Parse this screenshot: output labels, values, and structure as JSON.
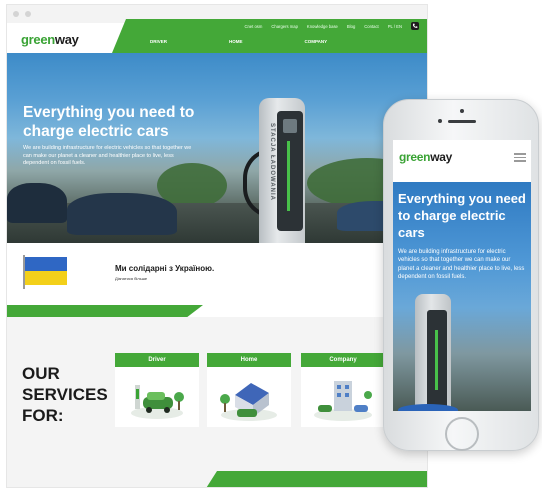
{
  "brand": {
    "name_part1": "green",
    "name_part2": "way",
    "accent_color": "#44a838"
  },
  "topbar": {
    "links": [
      "Cnet osm",
      "Chargers map",
      "Knowledge base",
      "Blog",
      "Contact",
      "PL / EN"
    ],
    "phone_icon": "phone-icon"
  },
  "nav": {
    "items": [
      "DRIVER",
      "HOME",
      "COMPANY"
    ]
  },
  "hero": {
    "title": "Everything you need to charge electric cars",
    "text": "We are building infrastructure for electric vehicles so that together we can make our planet a cleaner and healthier place to live, less dependent on fossil fuels.",
    "charger_label": "STACJA ŁADOWANIA"
  },
  "ukraine": {
    "title": "Ми солідарні з Україною.",
    "link": "Дізнатися більше"
  },
  "services": {
    "title_lines": [
      "OUR",
      "SERVICES",
      "FOR:"
    ],
    "cards": [
      "Driver",
      "Home",
      "Company"
    ]
  },
  "mobile": {
    "title": "Everything you need to charge electric cars",
    "text": "We are building infrastructure for electric vehicles so that together we can make our planet a cleaner and healthier place to live, less dependent on fossil fuels.",
    "menu_icon": "hamburger-menu-icon"
  }
}
